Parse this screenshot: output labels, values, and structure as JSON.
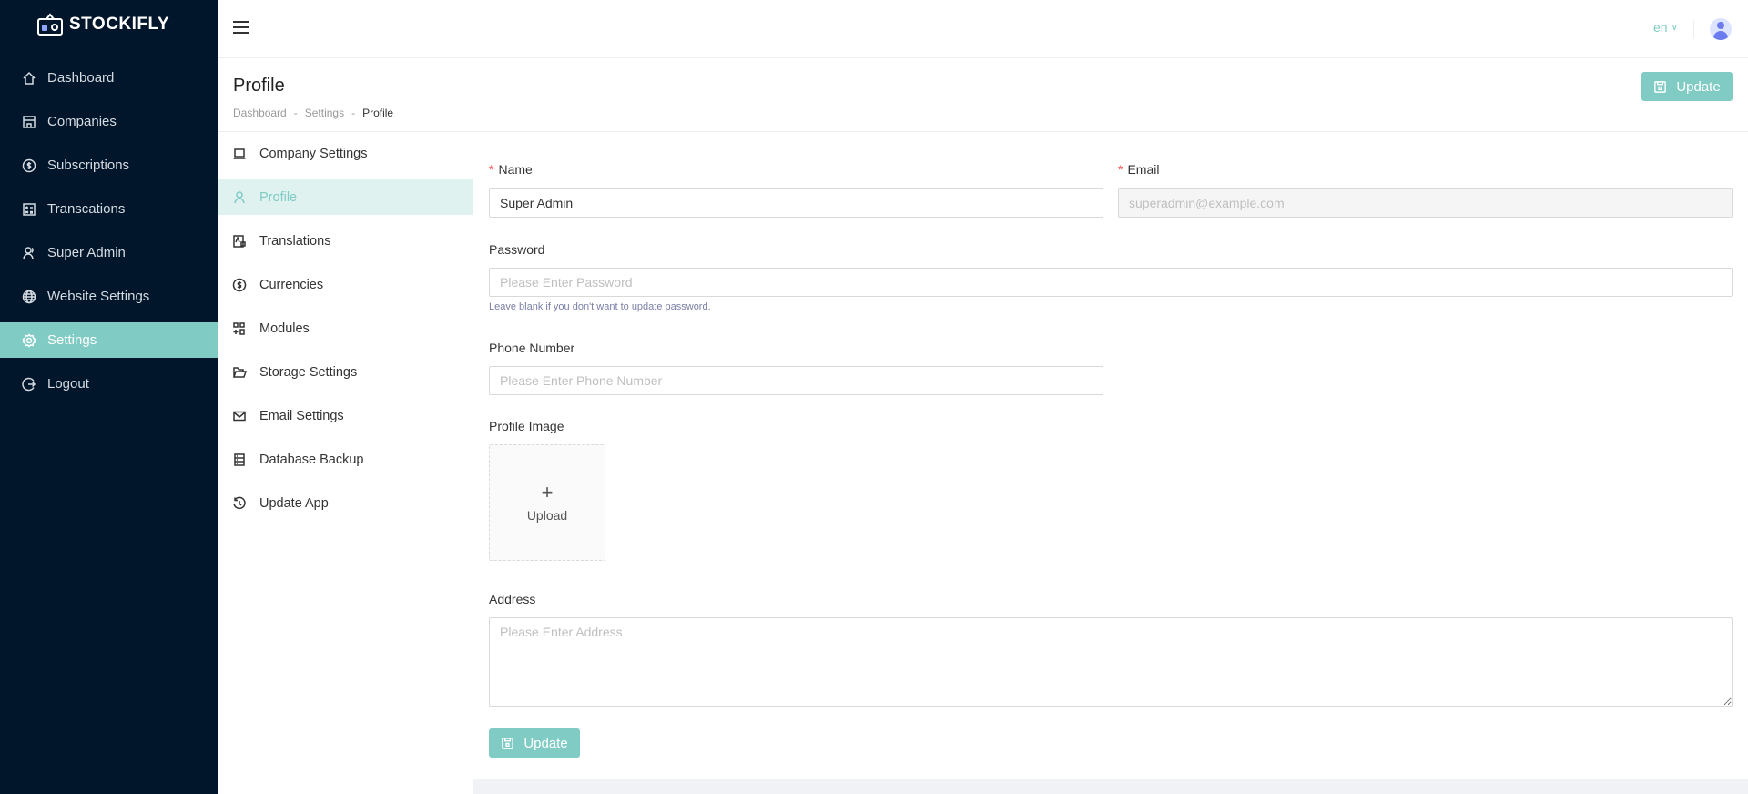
{
  "app": {
    "name": "STOCKIFLY"
  },
  "sidebar": {
    "items": [
      {
        "label": "Dashboard",
        "icon": "home-icon"
      },
      {
        "label": "Companies",
        "icon": "shop-icon"
      },
      {
        "label": "Subscriptions",
        "icon": "dollar-circle-icon"
      },
      {
        "label": "Transcations",
        "icon": "calculator-icon"
      },
      {
        "label": "Super Admin",
        "icon": "users-icon"
      },
      {
        "label": "Website Settings",
        "icon": "globe-icon"
      },
      {
        "label": "Settings",
        "icon": "gear-icon",
        "active": true
      },
      {
        "label": "Logout",
        "icon": "logout-icon"
      }
    ]
  },
  "topbar": {
    "language": "en"
  },
  "page": {
    "title": "Profile",
    "breadcrumb": [
      "Dashboard",
      "Settings",
      "Profile"
    ],
    "update_label": "Update"
  },
  "submenu": {
    "items": [
      {
        "label": "Company Settings",
        "icon": "laptop-icon"
      },
      {
        "label": "Profile",
        "icon": "user-icon",
        "active": true
      },
      {
        "label": "Translations",
        "icon": "translation-icon"
      },
      {
        "label": "Currencies",
        "icon": "dollar-circle-icon"
      },
      {
        "label": "Modules",
        "icon": "modules-icon"
      },
      {
        "label": "Storage Settings",
        "icon": "folder-open-icon"
      },
      {
        "label": "Email Settings",
        "icon": "mail-icon"
      },
      {
        "label": "Database Backup",
        "icon": "database-icon"
      },
      {
        "label": "Update App",
        "icon": "history-icon"
      }
    ]
  },
  "form": {
    "name": {
      "label": "Name",
      "value": "Super Admin"
    },
    "email": {
      "label": "Email",
      "value": "superadmin@example.com"
    },
    "password": {
      "label": "Password",
      "placeholder": "Please Enter Password",
      "hint": "Leave blank if you don't want to update password."
    },
    "phone": {
      "label": "Phone Number",
      "placeholder": "Please Enter Phone Number"
    },
    "profile_image": {
      "label": "Profile Image",
      "upload_label": "Upload"
    },
    "address": {
      "label": "Address",
      "placeholder": "Please Enter Address"
    },
    "submit_label": "Update"
  },
  "colors": {
    "sidebar": "#01162b",
    "accent": "#80cbc4",
    "active_bg": "#e0f2f0"
  }
}
